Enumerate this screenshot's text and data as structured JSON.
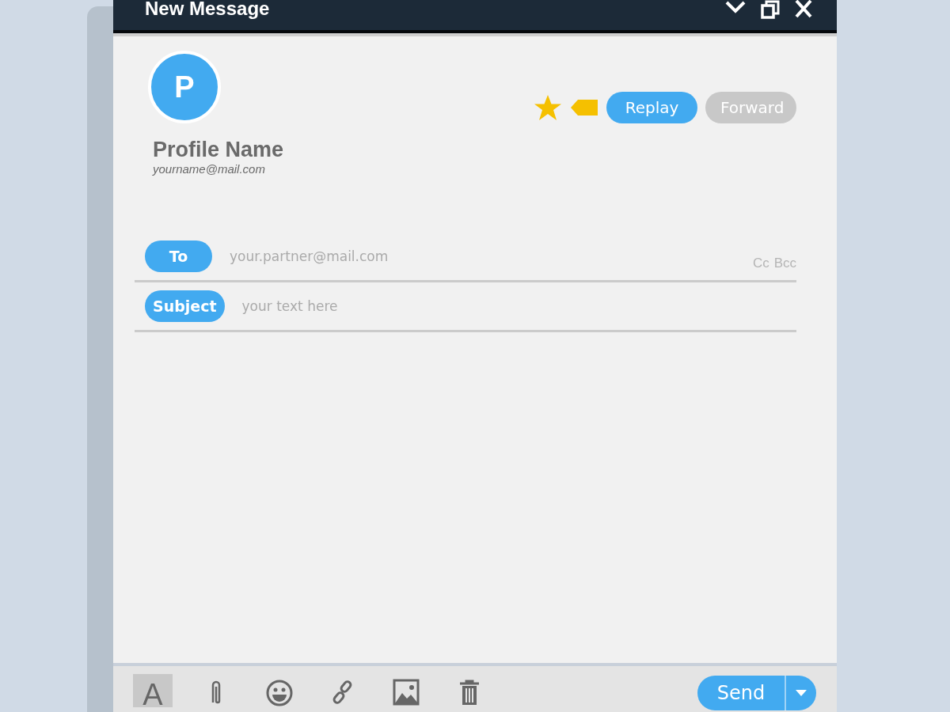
{
  "window": {
    "title": "New Message"
  },
  "profile": {
    "initial": "P",
    "name": "Profile Name",
    "email": "yourname@mail.com"
  },
  "actions": {
    "starred": true,
    "buttons": [
      {
        "label": "Replay",
        "kind": "primary"
      },
      {
        "label": "Forward",
        "kind": "secondary"
      }
    ]
  },
  "fields": [
    {
      "label": "To",
      "placeholder": "your.partner@mail.com",
      "extras": [
        "Cc",
        "Bcc"
      ]
    },
    {
      "label": "Subject",
      "placeholder": "your text here"
    }
  ],
  "toolbar": {
    "tools": [
      {
        "kind": "format",
        "label": "A",
        "selected": true
      },
      {
        "kind": "attach",
        "selected": false
      },
      {
        "kind": "emoji",
        "selected": false
      },
      {
        "kind": "link",
        "selected": false
      },
      {
        "kind": "image",
        "selected": false
      },
      {
        "kind": "trash",
        "selected": false
      }
    ],
    "send": "Send"
  }
}
